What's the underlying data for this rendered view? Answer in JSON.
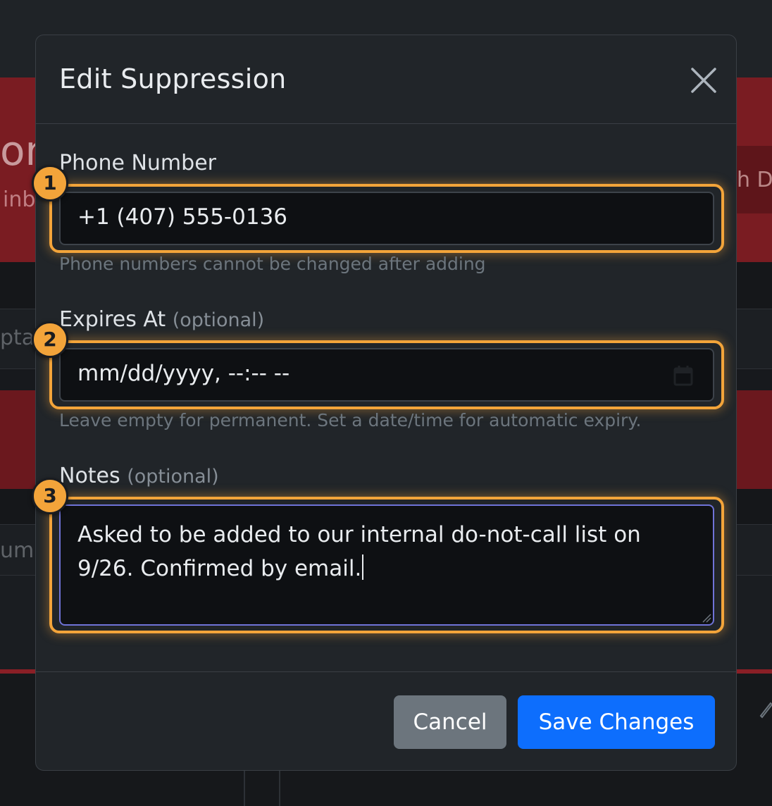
{
  "modal": {
    "title": "Edit Suppression",
    "close_icon": "close-icon"
  },
  "fields": {
    "phone": {
      "label": "Phone Number",
      "value": "+1 (407) 555-0136",
      "hint": "Phone numbers cannot be changed after adding",
      "badge": "1"
    },
    "expires": {
      "label": "Expires At",
      "optional": "(optional)",
      "value": "mm/dd/yyyy, --:-- --",
      "hint": "Leave empty for permanent. Set a date/time for automatic expiry.",
      "badge": "2",
      "icon": "calendar-icon"
    },
    "notes": {
      "label": "Notes",
      "optional": "(optional)",
      "value": "Asked to be added to our internal do-not-call list on 9/26. Confirmed by email.",
      "badge": "3"
    }
  },
  "footer": {
    "cancel_label": "Cancel",
    "save_label": "Save Changes"
  },
  "background": {
    "fragment_1": "on",
    "fragment_2": "inb",
    "fragment_3": "pta",
    "fragment_4": "umb",
    "fragment_5": "h D"
  },
  "colors": {
    "accent_highlight": "#f3a43a",
    "primary": "#0d6efd",
    "secondary": "#6c757d",
    "danger_bg": "#7a1c22"
  }
}
